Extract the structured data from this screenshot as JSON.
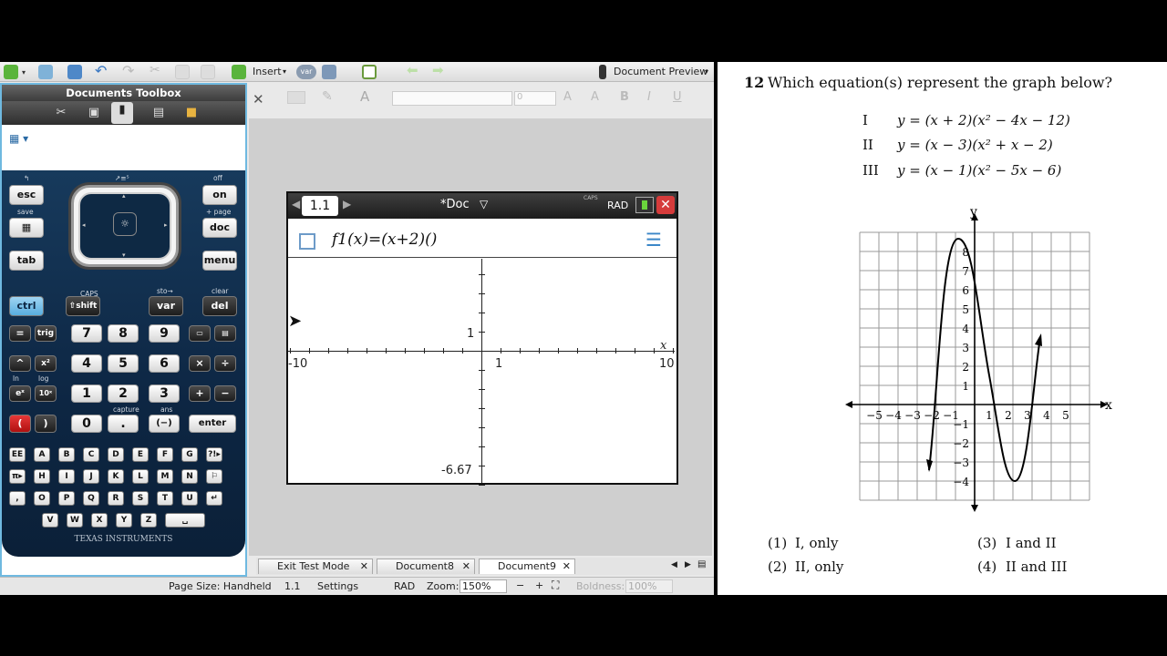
{
  "toolbar": {
    "insert": "Insert",
    "var": "var",
    "doc_preview": "Document Preview"
  },
  "format_bar": {
    "font_size": "0",
    "bold": "B",
    "italic": "I",
    "underline": "U"
  },
  "toolbox": {
    "title": "Documents Toolbox"
  },
  "calculator": {
    "brand": "TEXAS INSTRUMENTS",
    "keys": {
      "esc": "esc",
      "on": "on",
      "tab": "tab",
      "doc": "doc",
      "menu": "menu",
      "ctrl": "ctrl",
      "shift": "shift",
      "var": "var",
      "del": "del",
      "eq": "=",
      "trig": "trig",
      "n7": "7",
      "n8": "8",
      "n9": "9",
      "pow": "^",
      "sq": "x²",
      "n4": "4",
      "n5": "5",
      "n6": "6",
      "mul": "×",
      "div": "÷",
      "exp": "eˣ",
      "ten": "10ˣ",
      "n1": "1",
      "n2": "2",
      "n3": "3",
      "plus": "+",
      "minus": "−",
      "lp": "(",
      "rp": ")",
      "n0": "0",
      "dot": ".",
      "neg": "(−)",
      "enter": "enter",
      "alpha": [
        "EE",
        "A",
        "B",
        "C",
        "D",
        "E",
        "F",
        "G",
        "?!▸",
        "π▸",
        "H",
        "I",
        "J",
        "K",
        "L",
        "M",
        "N",
        "⚐",
        ",",
        "O",
        "P",
        "Q",
        "R",
        "S",
        "T",
        "U",
        "↵",
        "V",
        "W",
        "X",
        "Y",
        "Z",
        "␣"
      ]
    },
    "labels": {
      "off": "off",
      "save": "save",
      "page": "+ page",
      "caps": "CAPS",
      "sto": "sto→",
      "clear": "clear",
      "capture": "capture",
      "ans": "ans",
      "ln": "ln",
      "log": "log"
    }
  },
  "handheld": {
    "page_tab": "1.1",
    "doc_name": "*Doc",
    "caps": "CAPS",
    "mode": "RAD",
    "entry_text": "f1(x)=(x+2)()",
    "graph": {
      "x_min": "-10",
      "x_max": "10",
      "y_max": "1",
      "y_min": "-6.67",
      "x_tick": "1",
      "x_axis_label": "x"
    }
  },
  "doc_tabs": [
    {
      "label": "Exit Test Mode"
    },
    {
      "label": "Document8"
    },
    {
      "label": "Document9"
    }
  ],
  "status": {
    "page_size": "Page Size: Handheld",
    "page": "1.1",
    "settings": "Settings",
    "mode": "RAD",
    "zoom_label": "Zoom:",
    "zoom": "150%",
    "boldness_label": "Boldness:",
    "boldness": "100%"
  },
  "problem": {
    "number": "12",
    "question": "Which equation(s) represent the graph below?",
    "equations": [
      {
        "roman": "I",
        "eq": "y = (x + 2)(x² − 4x − 12)"
      },
      {
        "roman": "II",
        "eq": "y = (x − 3)(x² + x − 2)"
      },
      {
        "roman": "III",
        "eq": "y = (x − 1)(x² − 5x − 6)"
      }
    ],
    "choices": [
      {
        "num": "(1)",
        "text": "I, only"
      },
      {
        "num": "(3)",
        "text": "I and II"
      },
      {
        "num": "(2)",
        "text": "II, only"
      },
      {
        "num": "(4)",
        "text": "II and III"
      }
    ],
    "graph": {
      "x_label": "x",
      "y_label": "y",
      "x_ticks": [
        "−5",
        "−4",
        "−3",
        "−2",
        "−1",
        "1",
        "2",
        "3",
        "4",
        "5"
      ],
      "y_ticks": [
        "8",
        "7",
        "6",
        "5",
        "4",
        "3",
        "2",
        "1",
        "−1",
        "−2",
        "−3",
        "−4"
      ]
    }
  }
}
